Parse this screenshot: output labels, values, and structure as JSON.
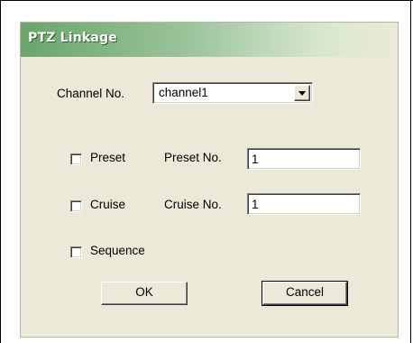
{
  "dialog": {
    "title": "PTZ Linkage",
    "channel": {
      "label": "Channel No.",
      "selected": "channel1"
    },
    "preset": {
      "checkbox_label": "Preset",
      "checked": false,
      "number_label": "Preset No.",
      "number_value": "1"
    },
    "cruise": {
      "checkbox_label": "Cruise",
      "checked": false,
      "number_label": "Cruise No.",
      "number_value": "1"
    },
    "sequence": {
      "checkbox_label": "Sequence",
      "checked": false
    },
    "buttons": {
      "ok": "OK",
      "cancel": "Cancel"
    }
  }
}
